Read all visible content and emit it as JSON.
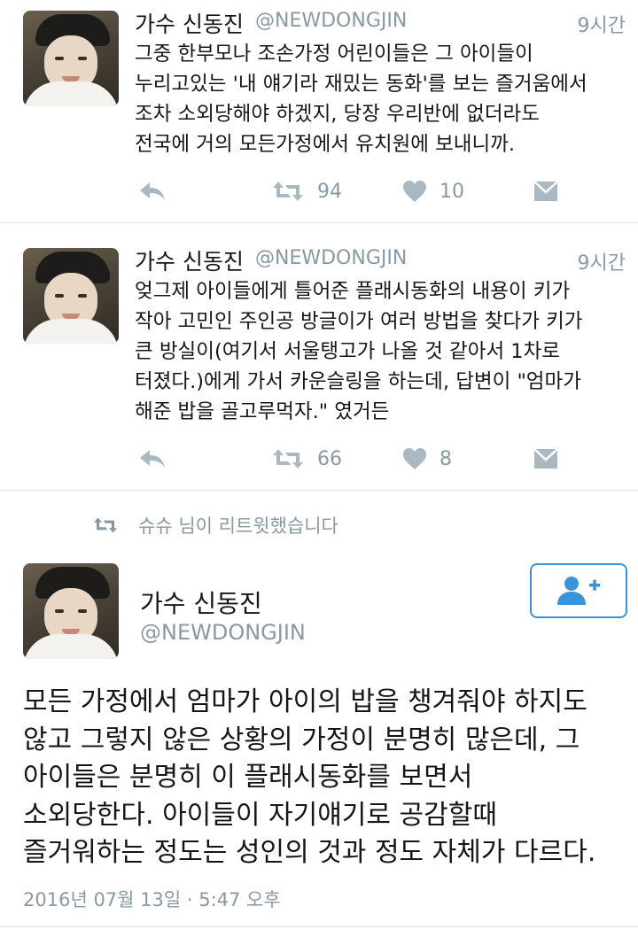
{
  "tweets": [
    {
      "name": "가수 신동진",
      "handle": "@NEWDONGJIN",
      "time": "9시간",
      "text": "그중 한부모나 조손가정 어린이들은 그 아이들이\n누리고있는 '내 얘기라 재밌는 동화'를 보는 즐거움에서\n조차 소외당해야 하겠지, 당장 우리반에 없더라도\n전국에 거의 모든가정에서 유치원에 보내니까.",
      "retweets": "94",
      "likes": "10"
    },
    {
      "name": "가수 신동진",
      "handle": "@NEWDONGJIN",
      "time": "9시간",
      "text": "엊그제 아이들에게 틀어준 플래시동화의 내용이 키가\n작아 고민인 주인공 방글이가 여러 방법을 찾다가 키가\n큰 방실이(여기서 서울탱고가 나올 것 같아서 1차로\n터졌다.)에게 가서 카운슬링을 하는데, 답변이 \"엄마가\n해준 밥을 골고루먹자.\" 였거든",
      "retweets": "66",
      "likes": "8"
    }
  ],
  "retweet_notice": "슈슈 님이 리트윗했습니다",
  "main_tweet": {
    "name": "가수 신동진",
    "handle": "@NEWDONGJIN",
    "text": "모든 가정에서 엄마가 아이의 밥을 챙겨줘야 하지도\n않고 그렇지 않은 상황의 가정이 분명히 많은데, 그\n아이들은 분명히 이 플래시동화를 보면서\n소외당한다. 아이들이 자기얘기로 공감할때\n즐거워하는 정도는 성인의 것과 정도 자체가 다르다.",
    "date": "2016년 07월 13일 · 5:47 오후"
  },
  "icons": {
    "reply": "reply-icon",
    "retweet": "retweet-icon",
    "like": "heart-icon",
    "dm": "envelope-icon",
    "follow": "follow-user-icon"
  },
  "colors": {
    "accent": "#3b94d9",
    "muted": "#8899a6",
    "icon": "#aab8c2",
    "text": "#14171a"
  }
}
